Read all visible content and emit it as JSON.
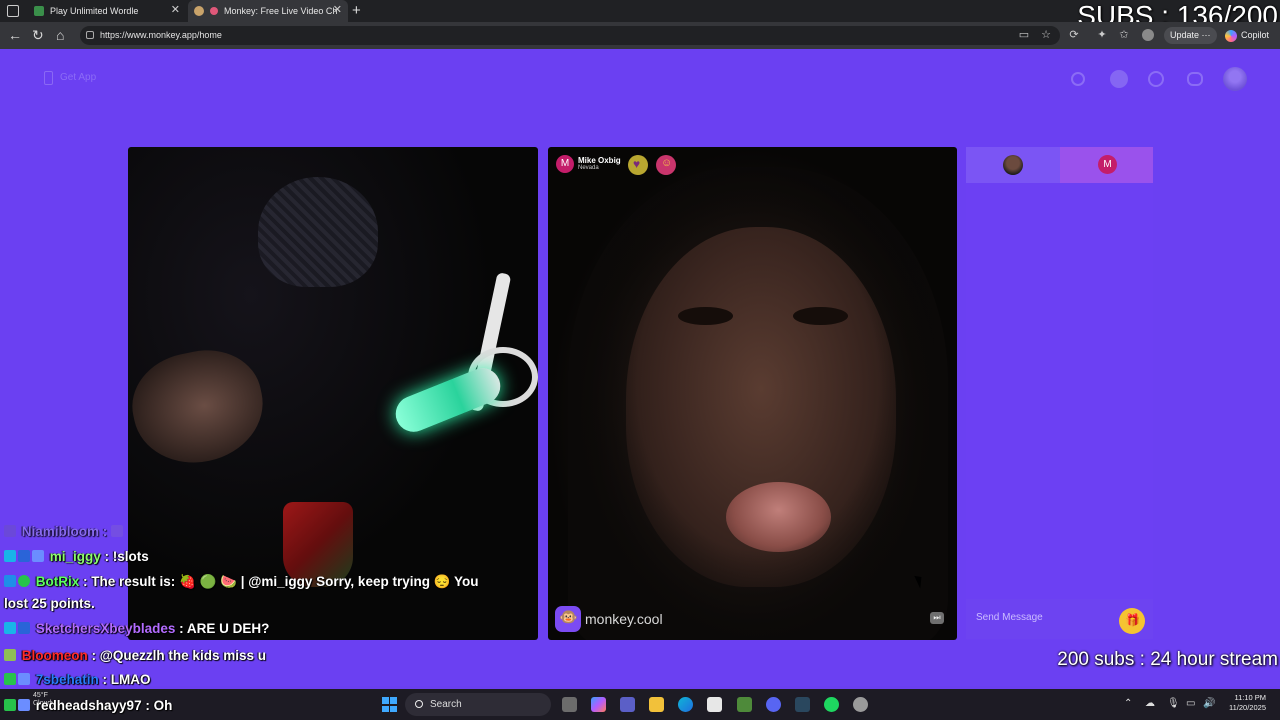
{
  "browser": {
    "tabs": [
      {
        "title": "Play Unlimited Wordle",
        "active": false
      },
      {
        "title": "Monkey: Free Live Video Ch",
        "active": true
      }
    ],
    "url": "https://www.monkey.app/home",
    "update_label": "Update",
    "copilot_label": "Copilot"
  },
  "stream_overlay": {
    "subs_counter": "SUBS : 136/200",
    "goal_text": "200 subs : 24 hour stream"
  },
  "site": {
    "get_app_label": "Get App",
    "remote_user": {
      "initial": "M",
      "name": "Mike Oxbig",
      "location": "Nevada"
    },
    "brand_text": "monkey.cool",
    "chat_tab_initial": "M",
    "send_placeholder": "Send Message"
  },
  "stream_chat": [
    {
      "user": "Niamibloom",
      "message": "",
      "style": "faded"
    },
    {
      "user": "mi_iggy",
      "message": "!slots",
      "style": "iggy"
    },
    {
      "user": "BotRix",
      "message": "The result is: 🍓 🟢 🍉 | @mi_iggy Sorry, keep trying 😔 You",
      "continuation": "lost 25 points.",
      "style": "botrix"
    },
    {
      "user": "SketchersXbeyblades",
      "message": "ARE U DEH?",
      "style": "sk"
    },
    {
      "user": "Bloomeon",
      "message": "@Quezzlh the kids miss u",
      "style": "red"
    },
    {
      "user": "7sbehatin",
      "message": "LMAO",
      "style": "blue"
    },
    {
      "user": "redheadshayy97",
      "message": "Oh",
      "style": "plain"
    }
  ],
  "taskbar": {
    "weather_temp": "45°F",
    "weather_desc": "Cloudy",
    "search_label": "Search",
    "time": "11:10 PM",
    "date": "11/20/2025"
  },
  "colors": {
    "brand_purple": "#6b40f2",
    "avatar_magenta": "#c41d6a",
    "gift_yellow": "#f5c431"
  }
}
